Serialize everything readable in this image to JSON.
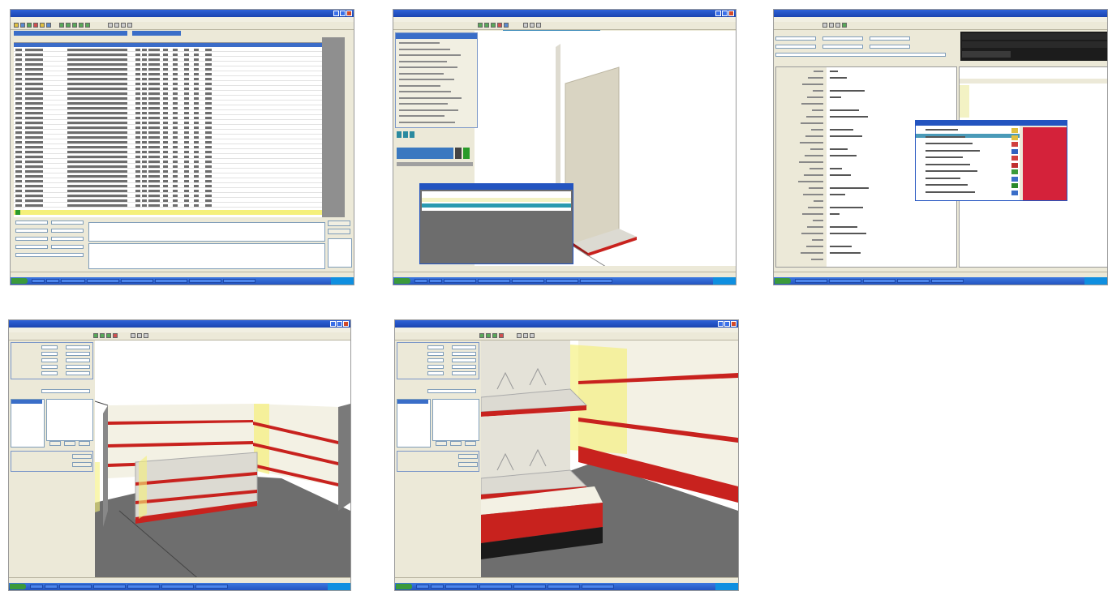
{
  "screenshots": [
    {
      "title": "",
      "view": "product-list"
    },
    {
      "title": "",
      "view": "fixture-editor-with-menu"
    },
    {
      "title": "",
      "view": "properties-and-color-picker"
    },
    {
      "title": "",
      "view": "3d-store-view-wide"
    },
    {
      "title": "",
      "view": "3d-store-view-closeup"
    }
  ],
  "colors": {
    "titlebar": "#2354c0",
    "taskbar": "#2f66d4",
    "start_button": "#3b9a3b",
    "shelf_red": "#c8221e",
    "floor_grey": "#6e6e6e",
    "wall_cream": "#f3f1e4",
    "highlight_yellow": "#f5f07a",
    "color_swatch_red": "#d4223a"
  },
  "icons": [
    "window-minimize-icon",
    "window-maximize-icon",
    "window-close-icon",
    "start-icon",
    "toolbar-icon",
    "paint-palette-icon"
  ]
}
